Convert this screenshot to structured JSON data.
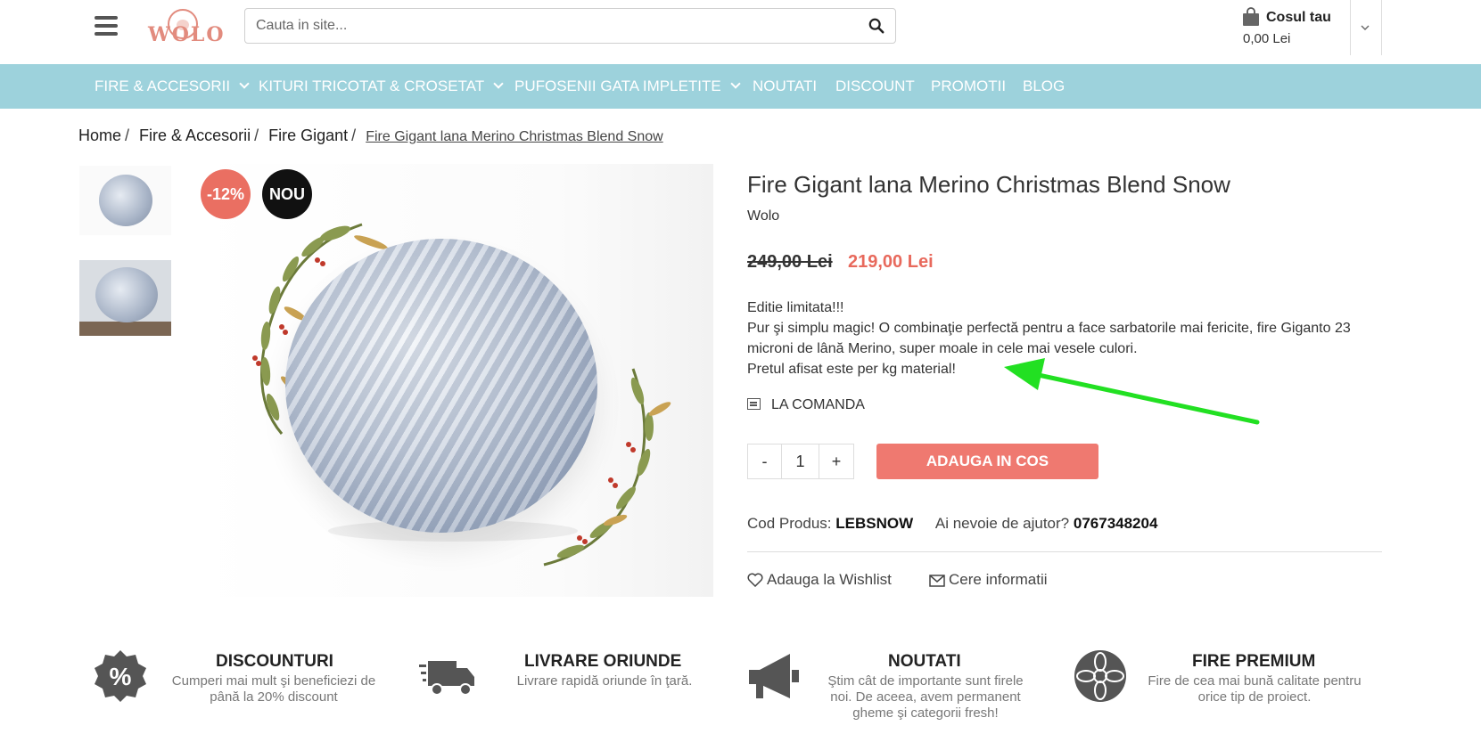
{
  "header": {
    "logo_text": "WOLO",
    "search_placeholder": "Cauta in site...",
    "cart_title": "Cosul tau",
    "cart_total": "0,00 Lei"
  },
  "nav": {
    "items": [
      {
        "label": "FIRE & ACCESORII",
        "dropdown": true
      },
      {
        "label": "KITURI TRICOTAT & CROSETAT",
        "dropdown": true
      },
      {
        "label": "PUFOSENII GATA IMPLETITE",
        "dropdown": true
      },
      {
        "label": "NOUTATI",
        "dropdown": false
      },
      {
        "label": "DISCOUNT",
        "dropdown": false
      },
      {
        "label": "PROMOTII",
        "dropdown": false
      },
      {
        "label": "BLOG",
        "dropdown": false
      }
    ]
  },
  "breadcrumb": {
    "items": [
      "Home",
      "Fire & Accesorii",
      "Fire Gigant"
    ],
    "separator": "/",
    "current": "Fire Gigant lana Merino Christmas Blend Snow"
  },
  "badges": {
    "discount": "-12%",
    "new": "NOU"
  },
  "product": {
    "title": "Fire Gigant lana Merino Christmas Blend Snow",
    "brand": "Wolo",
    "old_price": "249,00 Lei",
    "new_price": "219,00 Lei",
    "description": [
      "Editie limitata!!!",
      "Pur şi simplu magic! O combinaţie perfectă pentru a face sarbatorile mai fericite, fire Giganto 23 microni de lână Merino, super moale in cele mai vesele culori.",
      "Pretul afisat este per kg material!"
    ],
    "stock": "LA COMANDA",
    "qty_minus": "-",
    "qty_value": "1",
    "qty_plus": "+",
    "add_to_cart": "ADAUGA IN COS",
    "code_label": "Cod Produs:",
    "code_value": "LEBSNOW",
    "help_label": "Ai nevoie de ajutor?",
    "help_phone": "0767348204",
    "wishlist": "Adauga la Wishlist",
    "request_info": "Cere informatii"
  },
  "features": [
    {
      "icon": "percent-badge-icon",
      "title": "DISCOUNTURI",
      "desc": "Cumperi mai mult şi beneficiezi de până la 20% discount"
    },
    {
      "icon": "delivery-truck-icon",
      "title": "LIVRARE ORIUNDE",
      "desc": "Livrare rapidă oriunde în ţară."
    },
    {
      "icon": "megaphone-icon",
      "title": "NOUTATI",
      "desc": "Ştim cât de importante sunt firele noi. De aceea, avem permanent gheme şi categorii fresh!"
    },
    {
      "icon": "flower-icon",
      "title": "FIRE PREMIUM",
      "desc": "Fire de cea mai bună calitate pentru orice tip de proiect."
    }
  ],
  "colors": {
    "nav_bg": "#9dd2dc",
    "accent_price": "#e8695c",
    "add_to_cart_bg": "#ef7970",
    "badge_discount": "#ea6f62",
    "badge_new": "#111111",
    "annotation_arrow": "#22e022"
  }
}
